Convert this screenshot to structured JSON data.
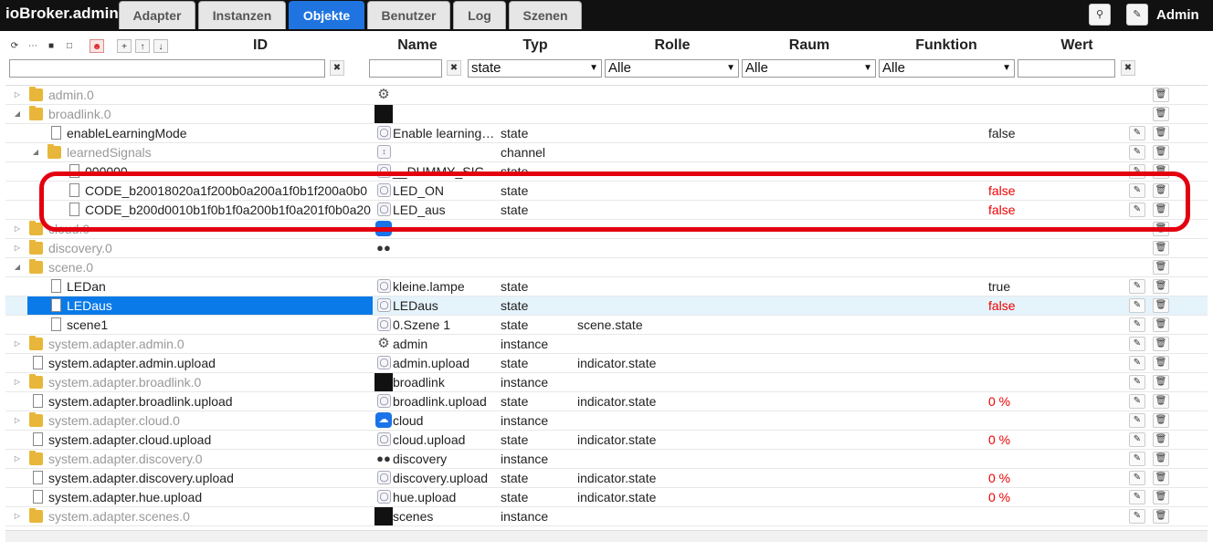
{
  "app": {
    "title": "ioBroker.admin",
    "user": "Admin"
  },
  "tabs": [
    "Adapter",
    "Instanzen",
    "Objekte",
    "Benutzer",
    "Log",
    "Szenen"
  ],
  "active_tab": "Objekte",
  "columns": {
    "id": "ID",
    "name": "Name",
    "type": "Typ",
    "role": "Rolle",
    "room": "Raum",
    "function": "Funktion",
    "value": "Wert"
  },
  "filters": {
    "type": "state",
    "role": "Alle",
    "room": "Alle",
    "function": "Alle"
  },
  "rows": [
    {
      "id": "admin.0",
      "name": "",
      "type": "",
      "role": "",
      "value": ""
    },
    {
      "id": "broadlink.0",
      "name": "",
      "type": "",
      "role": "",
      "value": ""
    },
    {
      "id": "enableLearningMode",
      "name": "Enable learning…",
      "type": "state",
      "role": "",
      "value": "false"
    },
    {
      "id": "learnedSignals",
      "name": "",
      "type": "channel",
      "role": "",
      "value": ""
    },
    {
      "id": "000000",
      "name": "__DUMMY_SIG…",
      "type": "state",
      "role": "",
      "value": ""
    },
    {
      "id": "CODE_b20018020a1f200b0a200a1f0b1f200a0b0",
      "name": "LED_ON",
      "type": "state",
      "role": "",
      "value": "false"
    },
    {
      "id": "CODE_b200d0010b1f0b1f0a200b1f0a201f0b0a20",
      "name": "LED_aus",
      "type": "state",
      "role": "",
      "value": "false"
    },
    {
      "id": "cloud.0",
      "name": "",
      "type": "",
      "role": "",
      "value": ""
    },
    {
      "id": "discovery.0",
      "name": "",
      "type": "",
      "role": "",
      "value": ""
    },
    {
      "id": "scene.0",
      "name": "",
      "type": "",
      "role": "",
      "value": ""
    },
    {
      "id": "LEDan",
      "name": "kleine.lampe",
      "type": "state",
      "role": "",
      "value": "true"
    },
    {
      "id": "LEDaus",
      "name": "LEDaus",
      "type": "state",
      "role": "",
      "value": "false"
    },
    {
      "id": "scene1",
      "name": "0.Szene 1",
      "type": "state",
      "role": "scene.state",
      "value": ""
    },
    {
      "id": "system.adapter.admin.0",
      "name": "admin",
      "type": "instance",
      "role": "",
      "value": ""
    },
    {
      "id": "system.adapter.admin.upload",
      "name": "admin.upload",
      "type": "state",
      "role": "indicator.state",
      "value": ""
    },
    {
      "id": "system.adapter.broadlink.0",
      "name": "broadlink",
      "type": "instance",
      "role": "",
      "value": ""
    },
    {
      "id": "system.adapter.broadlink.upload",
      "name": "broadlink.upload",
      "type": "state",
      "role": "indicator.state",
      "value": "0 %"
    },
    {
      "id": "system.adapter.cloud.0",
      "name": "cloud",
      "type": "instance",
      "role": "",
      "value": ""
    },
    {
      "id": "system.adapter.cloud.upload",
      "name": "cloud.upload",
      "type": "state",
      "role": "indicator.state",
      "value": "0 %"
    },
    {
      "id": "system.adapter.discovery.0",
      "name": "discovery",
      "type": "instance",
      "role": "",
      "value": ""
    },
    {
      "id": "system.adapter.discovery.upload",
      "name": "discovery.upload",
      "type": "state",
      "role": "indicator.state",
      "value": "0 %"
    },
    {
      "id": "system.adapter.hue.upload",
      "name": "hue.upload",
      "type": "state",
      "role": "indicator.state",
      "value": "0 %"
    },
    {
      "id": "system.adapter.scenes.0",
      "name": "scenes",
      "type": "instance",
      "role": "",
      "value": ""
    }
  ]
}
